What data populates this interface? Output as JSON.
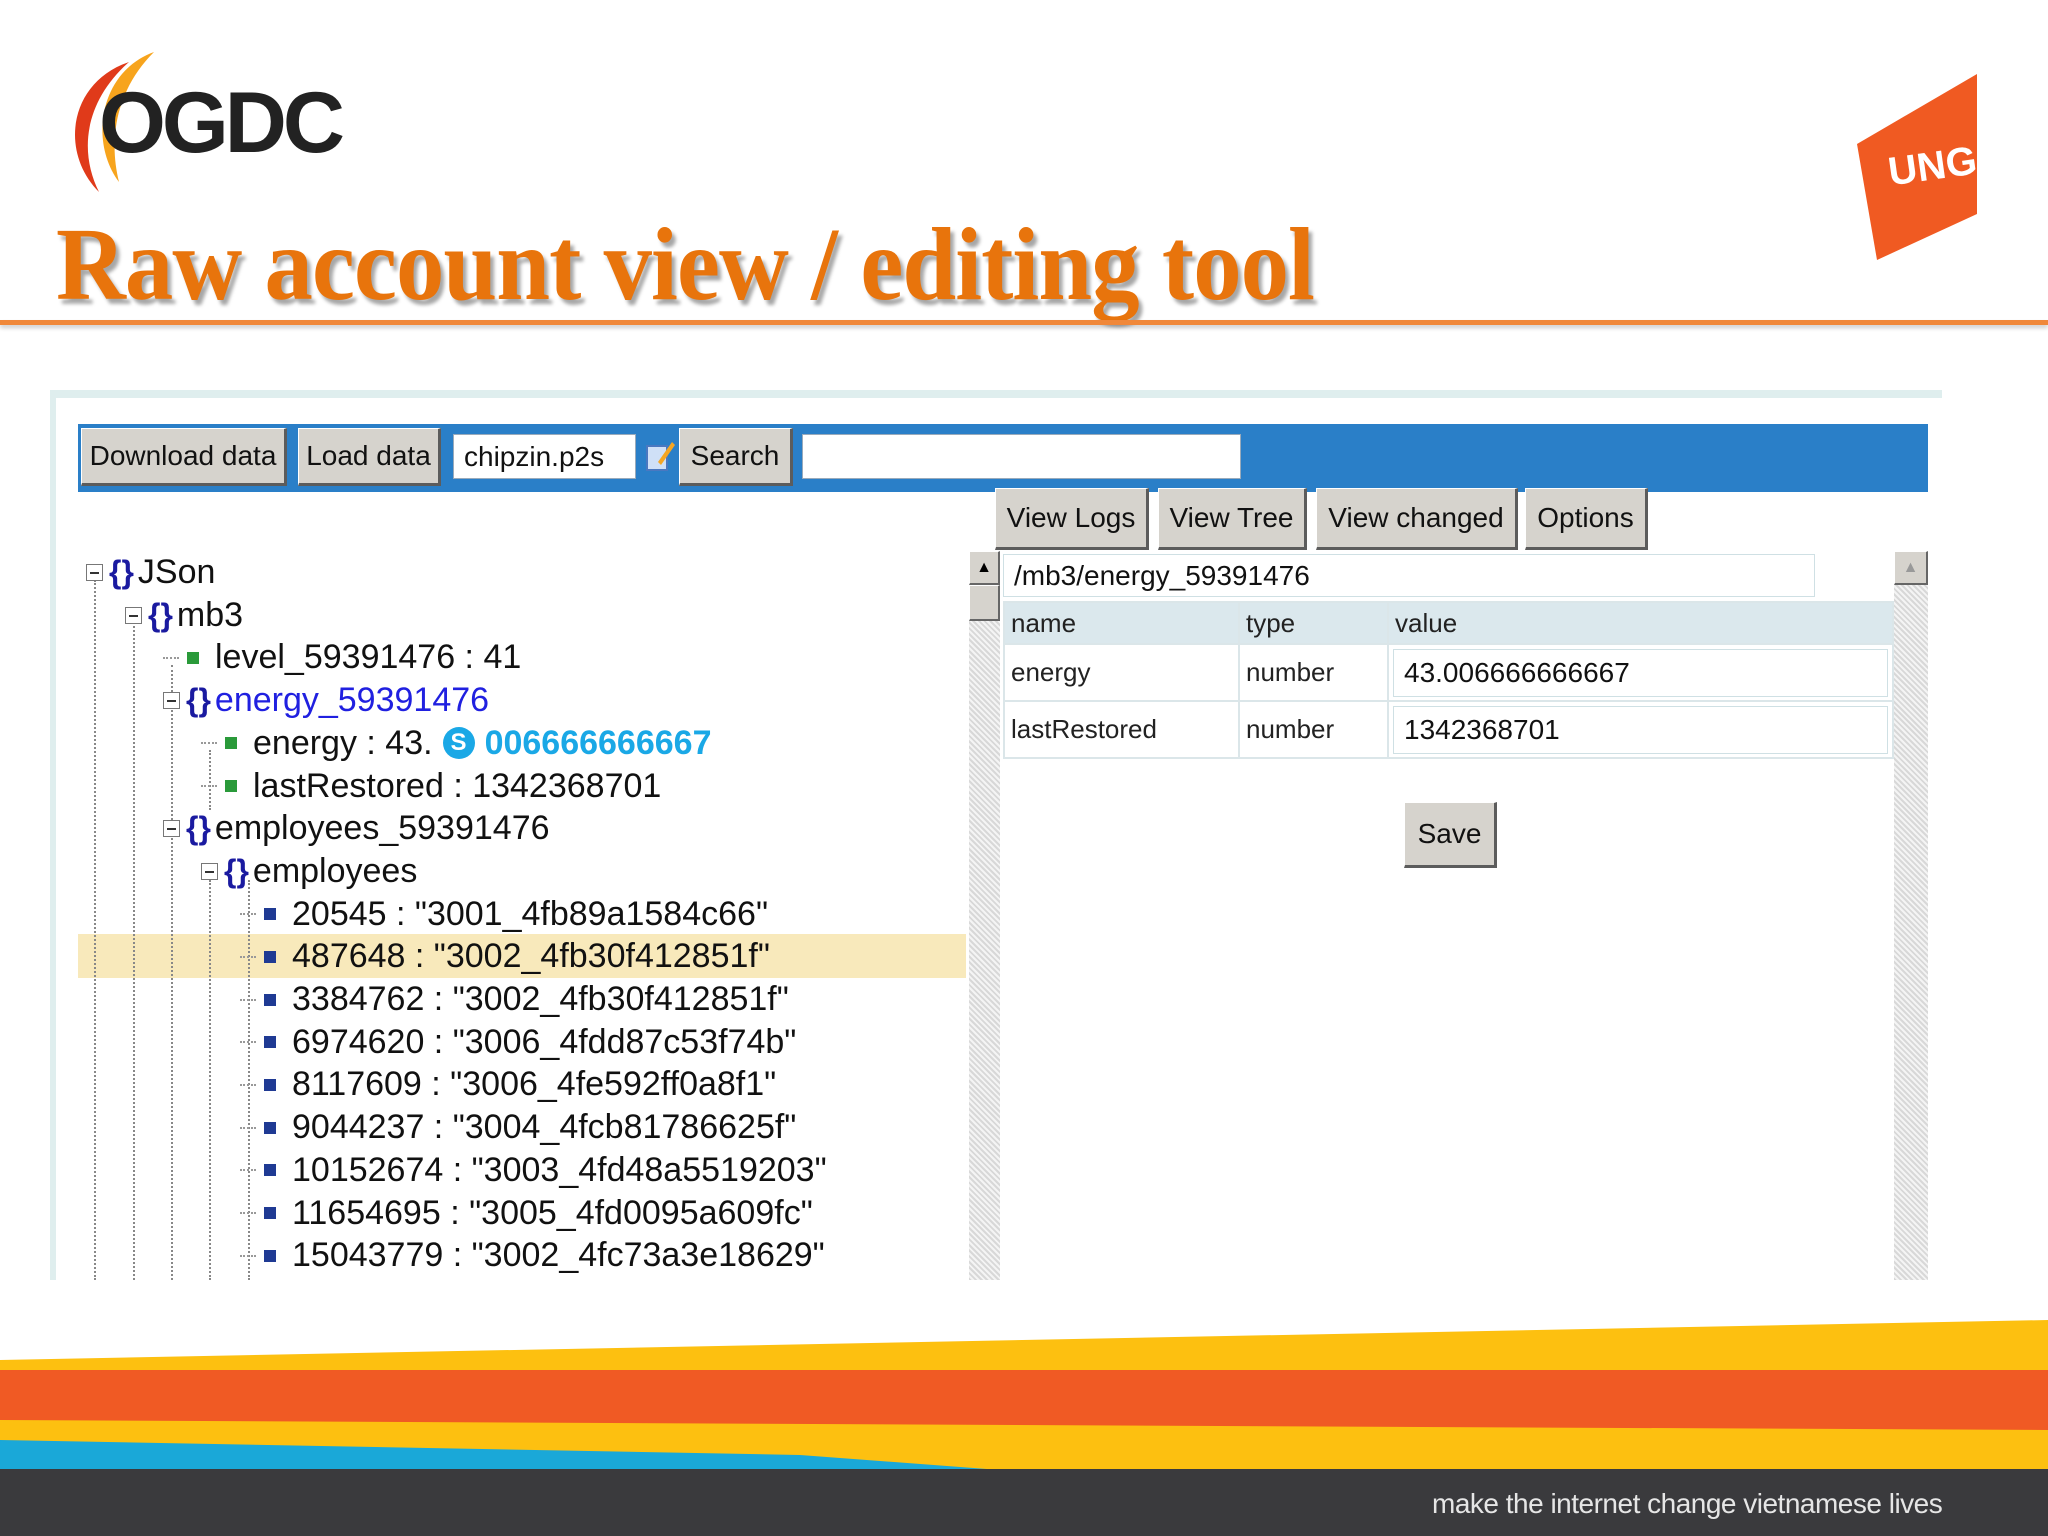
{
  "header": {
    "title": "Raw account view / editing tool",
    "logo_left": "OGDC",
    "logo_right": "UNG",
    "accent": "#e8740c"
  },
  "toolbar": {
    "download_label": "Download data",
    "load_label": "Load data",
    "account_value": "chipzin.p2s",
    "search_label": "Search",
    "search_value": ""
  },
  "tabs": [
    "View Logs",
    "View Tree",
    "View changed",
    "Options"
  ],
  "tree": [
    {
      "level": 0,
      "kind": "object",
      "text": "JSon"
    },
    {
      "level": 1,
      "kind": "object",
      "text": "mb3"
    },
    {
      "level": 2,
      "kind": "leaf",
      "text": "level_59391476 : 41"
    },
    {
      "level": 2,
      "kind": "object",
      "text": "energy_59391476",
      "selected_text": true
    },
    {
      "level": 3,
      "kind": "leaf",
      "text": "energy : 43.",
      "suffix": "006666666667"
    },
    {
      "level": 3,
      "kind": "leaf",
      "text": "lastRestored : 1342368701"
    },
    {
      "level": 2,
      "kind": "object",
      "text": "employees_59391476"
    },
    {
      "level": 3,
      "kind": "object",
      "text": "employees"
    },
    {
      "level": 4,
      "kind": "item",
      "text": "20545 : \"3001_4fb89a1584c66\""
    },
    {
      "level": 4,
      "kind": "item",
      "text": "487648 : \"3002_4fb30f412851f\"",
      "highlighted": true
    },
    {
      "level": 4,
      "kind": "item",
      "text": "3384762 : \"3002_4fb30f412851f\""
    },
    {
      "level": 4,
      "kind": "item",
      "text": "6974620 : \"3006_4fdd87c53f74b\""
    },
    {
      "level": 4,
      "kind": "item",
      "text": "8117609 : \"3006_4fe592ff0a8f1\""
    },
    {
      "level": 4,
      "kind": "item",
      "text": "9044237 : \"3004_4fcb81786625f\""
    },
    {
      "level": 4,
      "kind": "item",
      "text": "10152674 : \"3003_4fd48a5519203\""
    },
    {
      "level": 4,
      "kind": "item",
      "text": "11654695 : \"3005_4fd0095a609fc\""
    },
    {
      "level": 4,
      "kind": "item",
      "text": "15043779 : \"3002_4fc73a3e18629\""
    }
  ],
  "editor": {
    "path": "/mb3/energy_59391476",
    "columns": [
      "name",
      "type",
      "value"
    ],
    "rows": [
      {
        "name": "energy",
        "type": "number",
        "value": "43.006666666667"
      },
      {
        "name": "lastRestored",
        "type": "number",
        "value": "1342368701"
      }
    ],
    "save_label": "Save"
  },
  "footer": {
    "tagline": "make the internet change vietnamese lives"
  }
}
